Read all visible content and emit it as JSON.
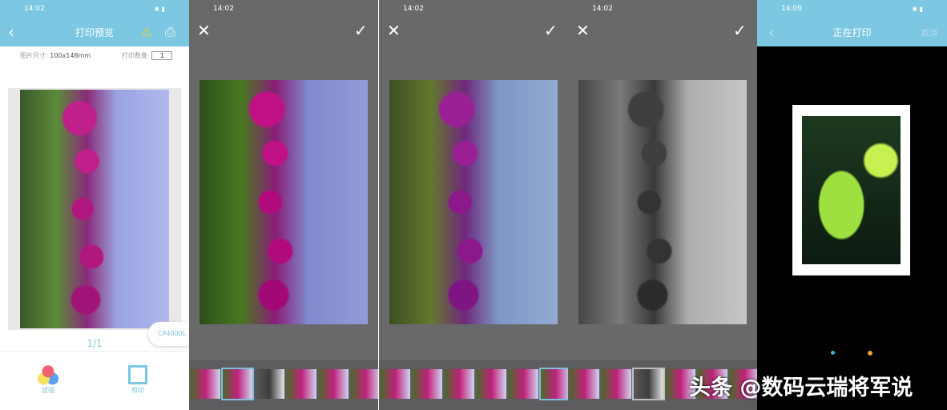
{
  "panel1": {
    "time": "14:02",
    "title": "打印预览",
    "size_label": "图片尺寸:",
    "size_value": "100x148mm",
    "qty_label": "打印数量:",
    "qty_value": "1",
    "page": "1/1",
    "printer": "CP4000L",
    "filter_label": "滤镜",
    "crop_label": "剪切"
  },
  "panel2": {
    "time": "14:02"
  },
  "panel3": {
    "time": "14:02"
  },
  "panel4": {
    "time": "14:02"
  },
  "panel5": {
    "time": "14:09",
    "title": "正在打印",
    "cancel": "取消"
  },
  "watermark": "头条 @数码云瑞将军说",
  "colors": {
    "header": "#7cc8e2",
    "editor_bg": "#69696c",
    "accent": "#7cc0e0"
  }
}
